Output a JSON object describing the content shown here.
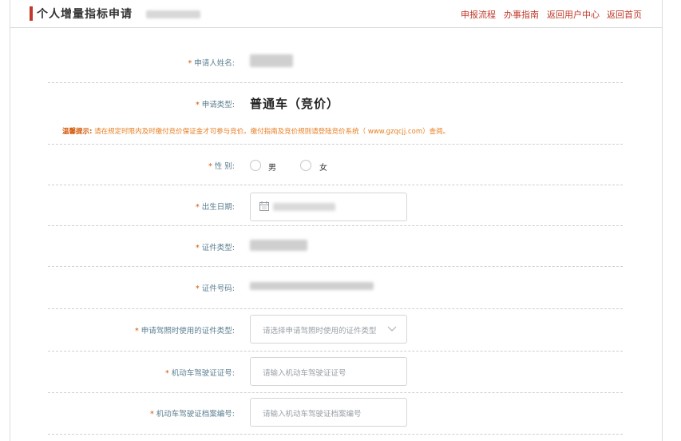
{
  "header": {
    "title": "个人增量指标申请",
    "nav": [
      {
        "label": "申报流程"
      },
      {
        "label": "办事指南"
      },
      {
        "label": "返回用户中心"
      },
      {
        "label": "返回首页"
      }
    ]
  },
  "form": {
    "required_mark": "*",
    "name": {
      "label": "申请人姓名:"
    },
    "apply_type": {
      "label": "申请类型:",
      "value": "普通车（竞价）"
    },
    "notice": {
      "prefix": "温馨提示:",
      "text": "请在规定时限内及时缴付竞价保证金才可参与竞价。缴付指南及竞价规则请登陆竞价系统（ www.gzqcjj.com）查阅。"
    },
    "gender": {
      "label": "性 别:",
      "options": [
        "男",
        "女"
      ]
    },
    "birth": {
      "label": "出生日期:"
    },
    "id_type": {
      "label": "证件类型:"
    },
    "id_number": {
      "label": "证件号码:"
    },
    "license_id_type": {
      "label": "申请驾照时使用的证件类型:",
      "placeholder": "请选择申请驾照时使用的证件类型"
    },
    "license_no": {
      "label": "机动车驾驶证证号:",
      "placeholder": "请输入机动车驾驶证证号"
    },
    "license_file_no": {
      "label": "机动车驾驶证档案编号:",
      "placeholder": "请输入机动车驾驶证档案编号"
    }
  },
  "colors": {
    "accent": "#c0392b",
    "label": "#5a7e8f",
    "notice": "#e67e22"
  }
}
